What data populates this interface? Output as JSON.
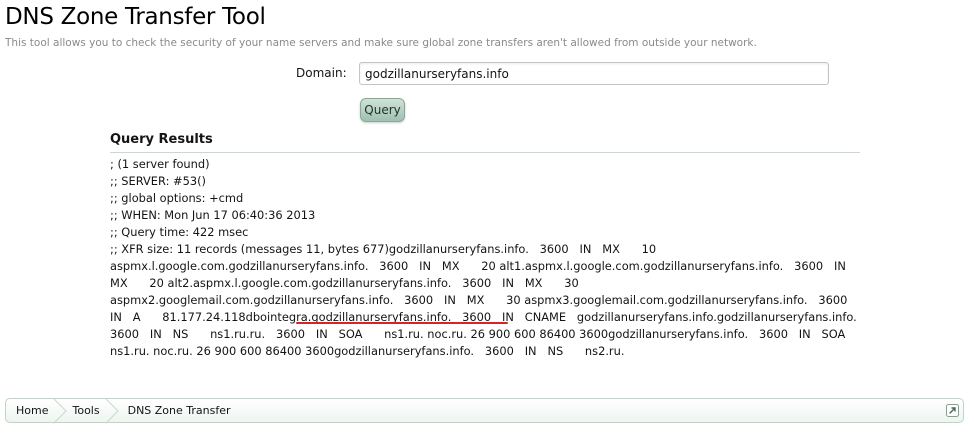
{
  "page": {
    "title": "DNS Zone Transfer Tool",
    "description": "This tool allows you to check the security of your name servers and make sure global zone transfers aren't allowed from outside your network."
  },
  "form": {
    "domain_label": "Domain:",
    "domain_value": "godzillanurseryfans.info",
    "query_button": "Query"
  },
  "results": {
    "heading": "Query Results",
    "lines": [
      "; (1 server found)",
      ";; SERVER: #53()",
      ";; global options: +cmd",
      ";; WHEN: Mon Jun 17 06:40:36 2013",
      ";; Query time: 422 msec"
    ],
    "records": ";; XFR size: 11 records (messages 11, bytes 677)godzillanurseryfans.info.   3600   IN   MX      10 aspmx.l.google.com.godzillanurseryfans.info.   3600   IN   MX      20 alt1.aspmx.l.google.com.godzillanurseryfans.info.   3600   IN   MX      20 alt2.aspmx.l.google.com.godzillanurseryfans.info.   3600   IN   MX      30 aspmx2.googlemail.com.godzillanurseryfans.info.   3600   IN   MX      30 aspmx3.googlemail.com.godzillanurseryfans.info.   3600   IN   A      81.177.24.118dbointegra.godzillanurseryfans.info.   3600   IN   CNAME   godzillanurseryfans.info.godzillanurseryfans.info.   3600   IN   NS      ns1.ru.ru.   3600   IN   SOA      ns1.ru. noc.ru. 26 900 600 86400 3600godzillanurseryfans.info.   3600   IN   SOA      ns1.ru. noc.ru. 26 900 600 86400 3600godzillanurseryfans.info.   3600   IN   NS      ns2.ru."
  },
  "breadcrumb": {
    "items": [
      "Home",
      "Tools"
    ],
    "current": "DNS Zone Transfer"
  },
  "colors": {
    "highlight_underline": "#d62424",
    "button_accent": "#9fc1b1"
  },
  "icons": {
    "breadcrumb_end": "jump-to-top-icon"
  }
}
